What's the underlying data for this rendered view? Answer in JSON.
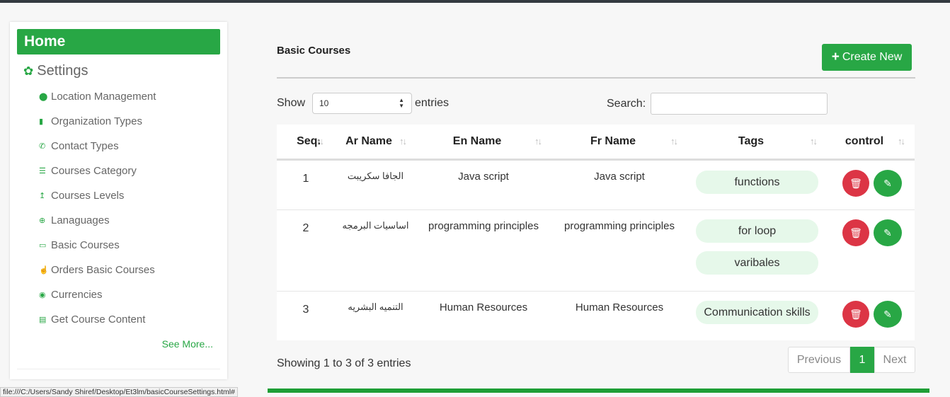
{
  "sidebar": {
    "home_label": "Home",
    "settings_label": "Settings",
    "items": [
      {
        "label": "Location Management",
        "icon": "map-marker-icon"
      },
      {
        "label": "Organization Types",
        "icon": "building-icon"
      },
      {
        "label": "Contact Types",
        "icon": "phone-icon"
      },
      {
        "label": "Courses Category",
        "icon": "list-icon"
      },
      {
        "label": "Courses Levels",
        "icon": "level-up-icon"
      },
      {
        "label": "Lanaguages",
        "icon": "globe-icon"
      },
      {
        "label": "Basic Courses",
        "icon": "laptop-icon"
      },
      {
        "label": "Orders Basic Courses",
        "icon": "hand-icon"
      },
      {
        "label": "Currencies",
        "icon": "money-icon"
      },
      {
        "label": "Get Course Content",
        "icon": "server-icon"
      }
    ],
    "see_more": "See More..."
  },
  "main": {
    "title": "Basic Courses",
    "create_label": "Create New",
    "show_label": "Show",
    "entries_value": "10",
    "entries_label": "entries",
    "search_label": "Search:",
    "search_value": ""
  },
  "table": {
    "headers": [
      "Seq.",
      "Ar Name",
      "En Name",
      "Fr Name",
      "Tags",
      "control"
    ],
    "rows": [
      {
        "seq": "1",
        "ar": "الجافا سكريبت",
        "en": "Java script",
        "fr": "Java script",
        "tags": [
          "functions"
        ]
      },
      {
        "seq": "2",
        "ar": "اساسيات البرمجه",
        "en": "programming principles",
        "fr": "programming principles",
        "tags": [
          "for loop",
          "varibales"
        ]
      },
      {
        "seq": "3",
        "ar": "التنميه البشريه",
        "en": "Human Resources",
        "fr": "Human Resources",
        "tags": [
          "Communication skills"
        ]
      }
    ]
  },
  "footer": {
    "showing": "Showing 1 to 3 of 3 entries",
    "previous": "Previous",
    "current_page": "1",
    "next": "Next"
  },
  "status_url": "file:///C:/Users/Sandy Shiref/Desktop/Et3lm/basicCourseSettings.html#",
  "colors": {
    "accent": "#28a745",
    "danger": "#dc3545",
    "tag_bg": "#e6f8ea"
  }
}
